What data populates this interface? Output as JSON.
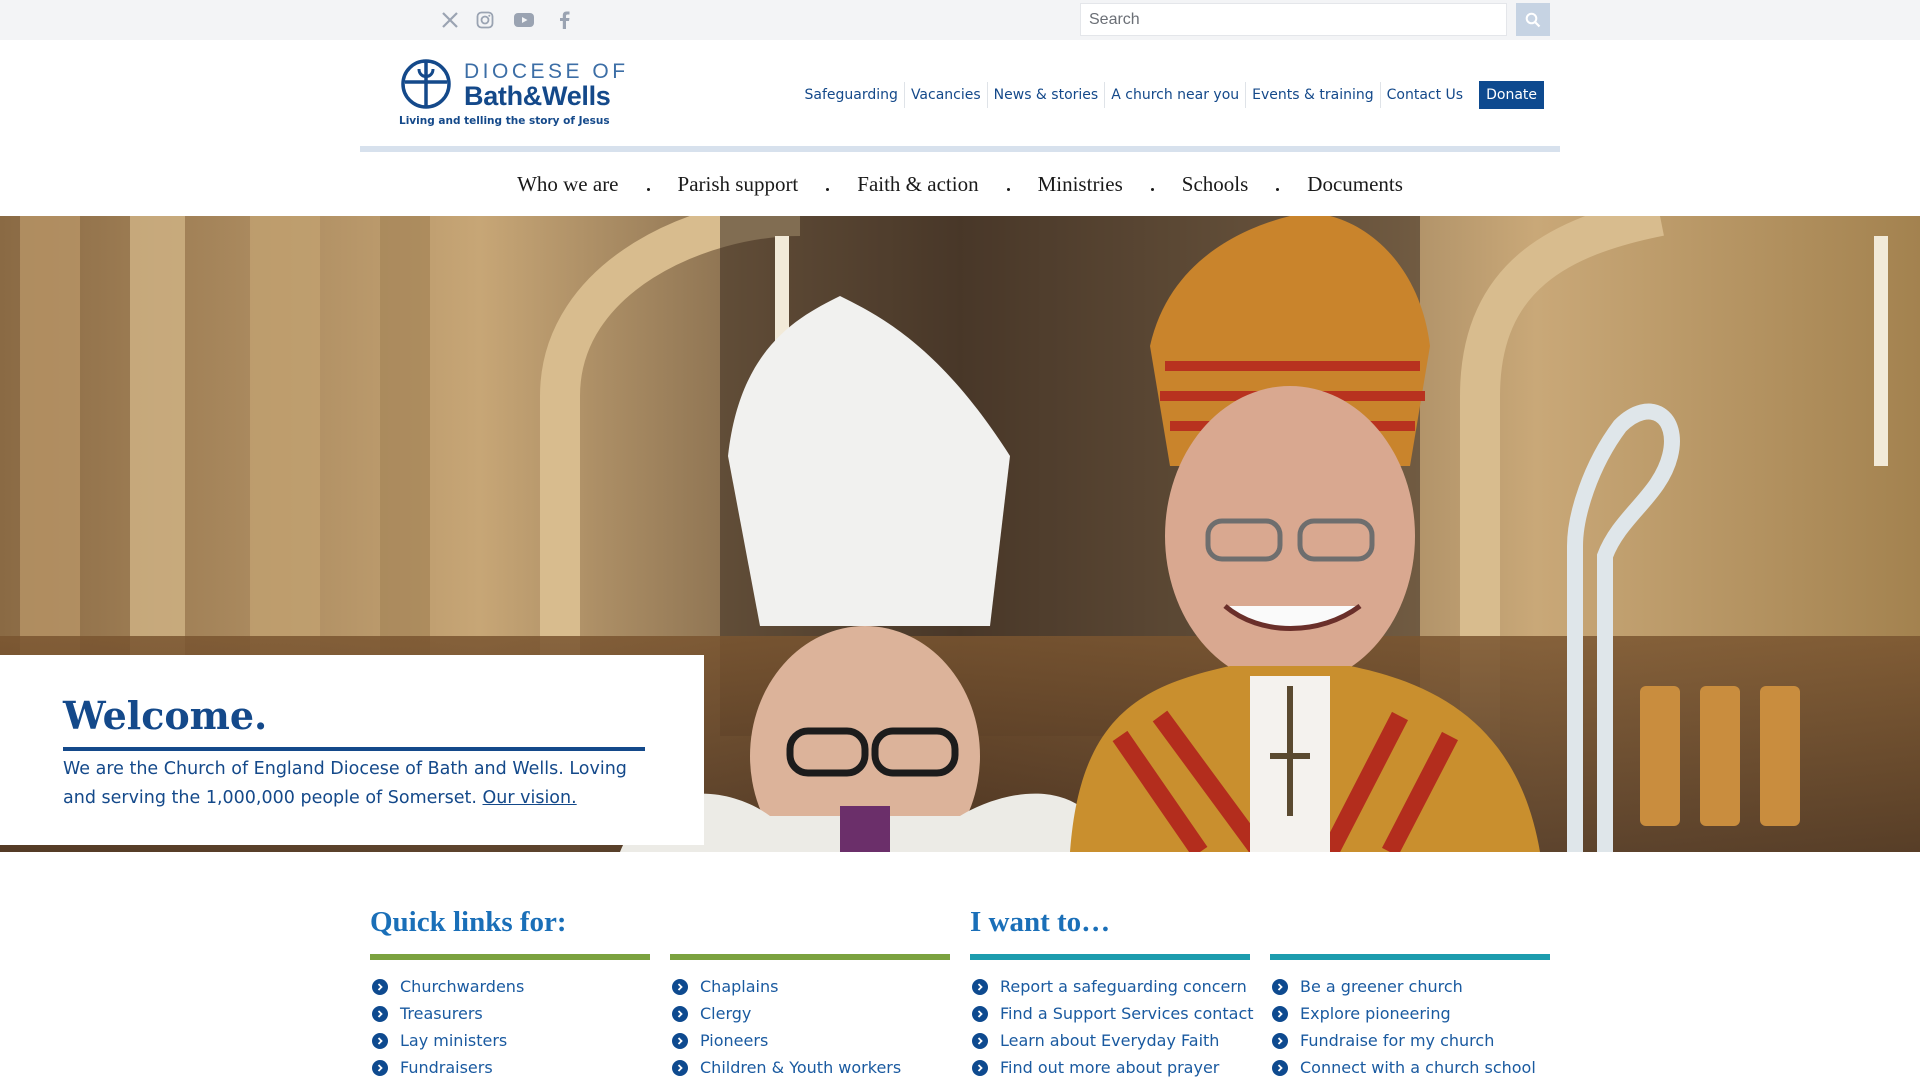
{
  "topbar": {
    "social": [
      {
        "icon": "x-icon"
      },
      {
        "icon": "instagram-icon"
      },
      {
        "icon": "youtube-icon"
      },
      {
        "icon": "facebook-icon"
      }
    ],
    "search": {
      "placeholder": "Search",
      "value": ""
    },
    "search_button_icon": "search-icon"
  },
  "header": {
    "logo": {
      "line1": "DIOCESE OF",
      "line2": "Bath&Wells",
      "tagline": "Living and telling the story of Jesus"
    },
    "utility_nav": [
      "Safeguarding",
      "Vacancies",
      "News & stories",
      "A church near you",
      "Events & training",
      "Contact Us"
    ],
    "donate_label": "Donate"
  },
  "main_nav": [
    "Who we are",
    "Parish support",
    "Faith & action",
    "Ministries",
    "Schools",
    "Documents"
  ],
  "hero": {
    "welcome_title": "Welcome.",
    "welcome_text": "We are the Church of England Diocese of Bath and Wells. Loving and serving the 1,000,000 people of Somerset.",
    "welcome_link": "Our vision."
  },
  "quick_links": {
    "title": "Quick links for:",
    "col1": [
      "Churchwardens",
      "Treasurers",
      "Lay ministers",
      "Fundraisers"
    ],
    "col2": [
      "Chaplains",
      "Clergy",
      "Pioneers",
      "Children & Youth workers"
    ]
  },
  "i_want_to": {
    "title": "I want to…",
    "col1": [
      "Report a safeguarding concern",
      "Find a Support Services contact",
      "Learn about Everyday Faith",
      "Find out more about prayer"
    ],
    "col2": [
      "Be a greener church",
      "Explore pioneering",
      "Fundraise for my church",
      "Connect with a church school"
    ]
  },
  "colors": {
    "brand_blue": "#14498a",
    "link_blue": "#1a5aa0",
    "quick_links_accent": "#7ba23f",
    "i_want_to_accent": "#1d9cae"
  }
}
